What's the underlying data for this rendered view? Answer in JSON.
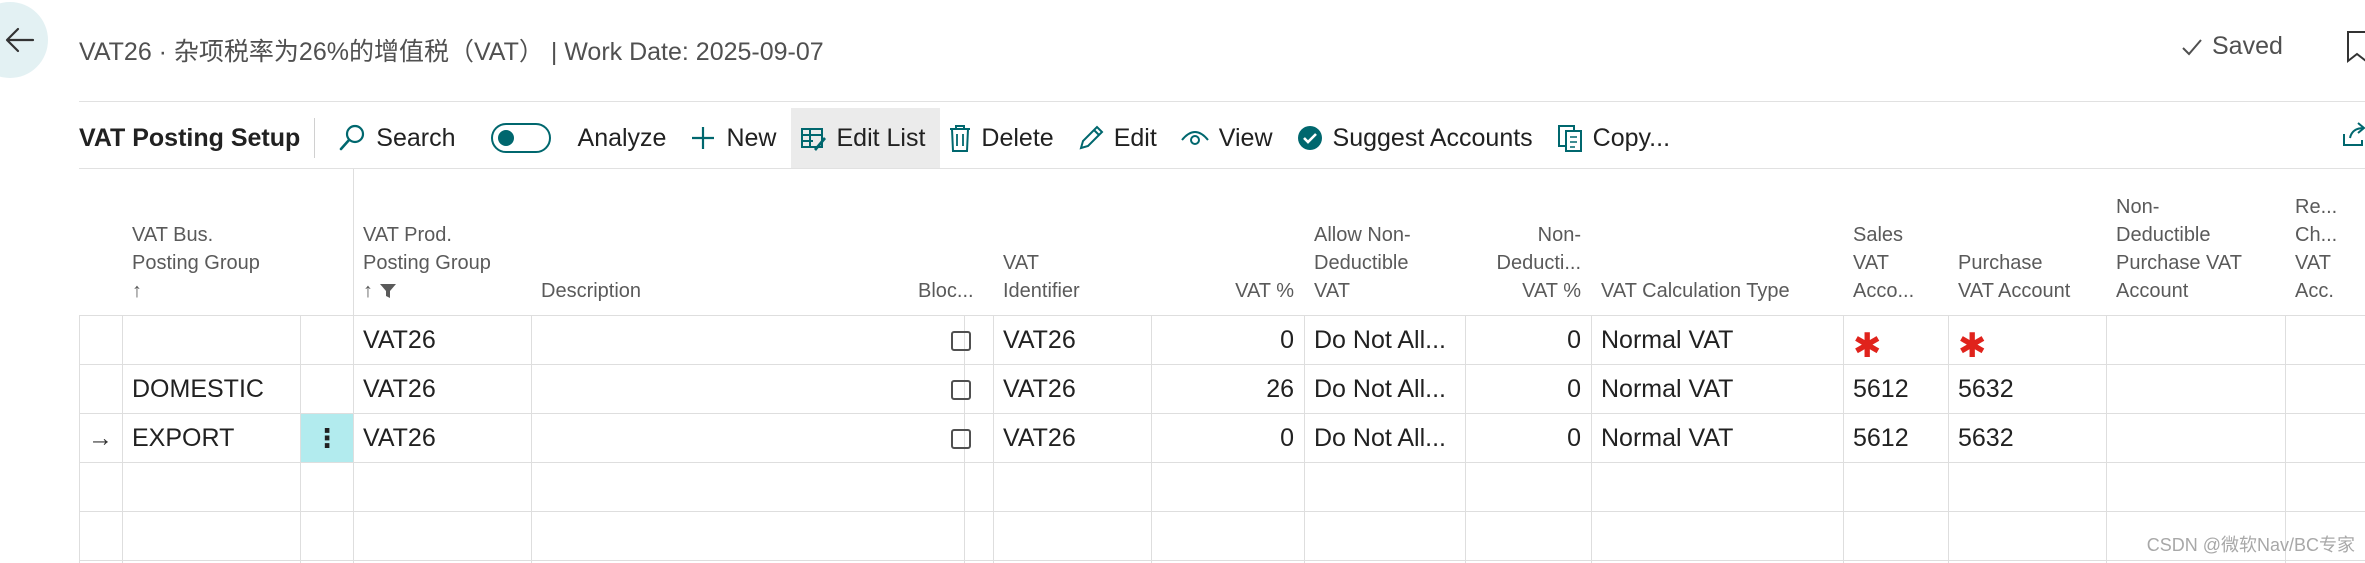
{
  "header": {
    "title": "VAT26 · 杂项税率为26%的增值税（VAT） | Work Date: 2025-09-07",
    "saved": "Saved"
  },
  "toolbar": {
    "page_title": "VAT Posting Setup",
    "search": "Search",
    "analyze": "Analyze",
    "new": "New",
    "edit_list": "Edit List",
    "delete": "Delete",
    "edit": "Edit",
    "view": "View",
    "suggest_accounts": "Suggest Accounts",
    "copy": "Copy..."
  },
  "colors": {
    "accent": "#00676e",
    "selected_cell": "#b2ebee",
    "required": "#e0231c"
  },
  "columns": {
    "bus_group_l1": "VAT Bus.",
    "bus_group_l2": "Posting Group",
    "bus_group_sort": "↑",
    "prod_group_l1": "VAT Prod.",
    "prod_group_l2": "Posting Group",
    "prod_group_sort": "↑",
    "description": "Description",
    "blocked": "Bloc...",
    "vat_identifier_l1": "VAT",
    "vat_identifier_l2": "Identifier",
    "vat_pct": "VAT %",
    "allow_nd_l1": "Allow Non-",
    "allow_nd_l2": "Deductible",
    "allow_nd_l3": "VAT",
    "nd_pct_l1": "Non-",
    "nd_pct_l2": "Deducti...",
    "nd_pct_l3": "VAT %",
    "calc_type": "VAT Calculation Type",
    "sales_acc_l1": "Sales",
    "sales_acc_l2": "VAT",
    "sales_acc_l3": "Acco...",
    "purch_acc_l1": "Purchase",
    "purch_acc_l2": "VAT Account",
    "nd_purch_l1": "Non-",
    "nd_purch_l2": "Deductible",
    "nd_purch_l3": "Purchase VAT",
    "nd_purch_l4": "Account",
    "rev_l1": "Re...",
    "rev_l2": "Ch...",
    "rev_l3": "VAT",
    "rev_l4": "Acc."
  },
  "rows": [
    {
      "bus_group": "",
      "prod_group": "VAT26",
      "vat_identifier": "VAT26",
      "vat_pct": "0",
      "allow_nd": "Do Not All...",
      "nd_pct": "0",
      "calc_type": "Normal VAT",
      "sales_acc": "",
      "purch_acc": "",
      "required_sales": "✱",
      "required_purch": "✱"
    },
    {
      "bus_group": "DOMESTIC",
      "prod_group": "VAT26",
      "vat_identifier": "VAT26",
      "vat_pct": "26",
      "allow_nd": "Do Not All...",
      "nd_pct": "0",
      "calc_type": "Normal VAT",
      "sales_acc": "5612",
      "purch_acc": "5632"
    },
    {
      "bus_group": "EXPORT",
      "prod_group": "VAT26",
      "vat_identifier": "VAT26",
      "vat_pct": "0",
      "allow_nd": "Do Not All...",
      "nd_pct": "0",
      "calc_type": "Normal VAT",
      "sales_acc": "5612",
      "purch_acc": "5632",
      "row_marker": "→",
      "row_menu": "⋮"
    }
  ],
  "watermark": "CSDN @微软Nav/BC专家"
}
